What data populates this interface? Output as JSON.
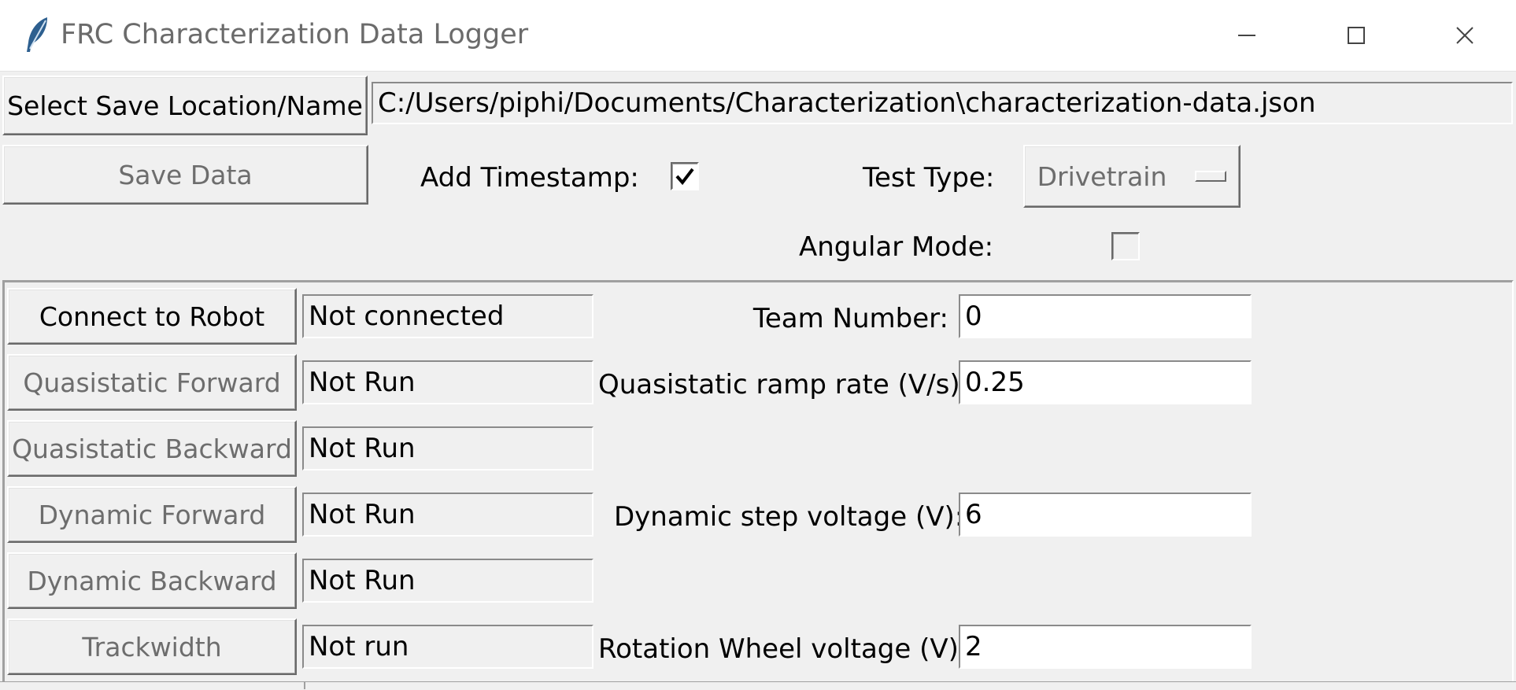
{
  "window": {
    "title": "FRC Characterization Data Logger",
    "icon": "feather-icon"
  },
  "toolbar": {
    "select_save_label": "Select Save Location/Name",
    "save_path": "C:/Users/piphi/Documents/Characterization\\characterization-data.json",
    "save_data_label": "Save Data",
    "add_timestamp_label": "Add Timestamp:",
    "add_timestamp_checked": true,
    "test_type_label": "Test Type:",
    "test_type_value": "Drivetrain",
    "angular_mode_label": "Angular Mode:",
    "angular_mode_checked": false
  },
  "tests": {
    "connect_label": "Connect to Robot",
    "connect_status": "Not connected",
    "rows": [
      {
        "label": "Quasistatic Forward",
        "status": "Not Run"
      },
      {
        "label": "Quasistatic Backward",
        "status": "Not Run"
      },
      {
        "label": "Dynamic Forward",
        "status": "Not Run"
      },
      {
        "label": "Dynamic Backward",
        "status": "Not Run"
      },
      {
        "label": "Trackwidth",
        "status": "Not run"
      }
    ]
  },
  "params": {
    "team_number_label": "Team Number:",
    "team_number_value": "0",
    "ramp_rate_label": "Quasistatic ramp rate (V/s):",
    "ramp_rate_value": "0.25",
    "step_voltage_label": "Dynamic step voltage (V):",
    "step_voltage_value": "6",
    "rotation_voltage_label": "Rotation Wheel voltage (V):",
    "rotation_voltage_value": "2"
  }
}
